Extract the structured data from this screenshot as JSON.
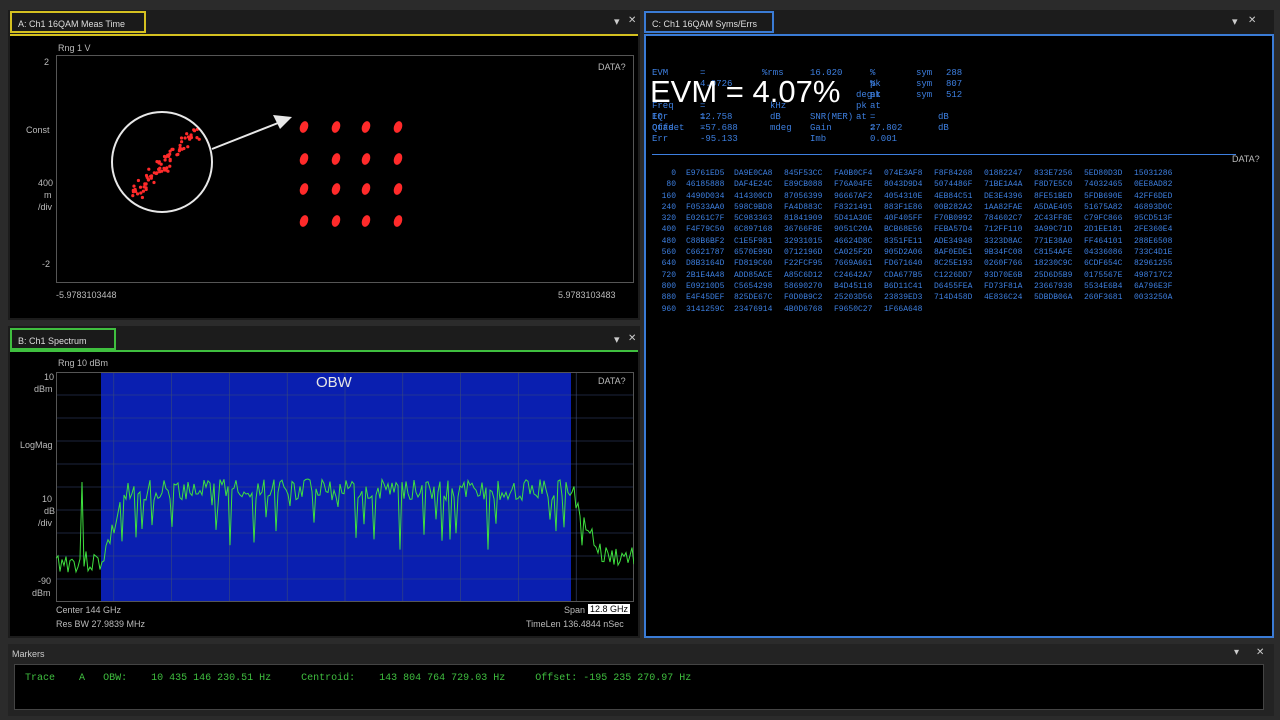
{
  "colors": {
    "panel_a_border": "#d4c020",
    "panel_b_border": "#3fbf3f",
    "panel_c_border": "#3a7bd5",
    "trace": "#3fe03f",
    "obw_fill": "#0a1fb0",
    "const_point": "#ff2a2a",
    "data_blue": "#3d7fe0"
  },
  "panel_a": {
    "title": "A: Ch1 16QAM Meas Time",
    "range": "Rng 1  V",
    "data_tag": "DATA?",
    "y_top": "2",
    "y_label": "Const",
    "y_mid": "400",
    "y_mid_unit1": "m",
    "y_mid_unit2": "/div",
    "y_bottom": "-2",
    "x_left": "-5.9783103448",
    "x_right": "5.9783103483"
  },
  "panel_b": {
    "title": "B: Ch1 Spectrum",
    "range": "Rng 10  dBm",
    "data_tag": "DATA?",
    "obw_label": "OBW",
    "y_top": "10",
    "y_top_unit": "dBm",
    "y_label": "LogMag",
    "y_scale": "10",
    "y_scale_unit1": "dB",
    "y_scale_unit2": "/div",
    "y_bottom": "-90",
    "y_bottom_unit": "dBm",
    "center": "Center 144 GHz",
    "res_bw": "Res BW 27.9839 MHz",
    "span_label": "Span",
    "span_value": "12.8 GHz",
    "timelen": "TimeLen 136.4844 nSec"
  },
  "panel_c": {
    "title": "C: Ch1 16QAM Syms/Errs",
    "evm_big": "EVM = 4.07%",
    "data_tag": "DATA?",
    "stats_row1": [
      "EVM",
      "= 4.0726",
      "%rms",
      "16.020",
      "% pk at",
      "sym",
      "288"
    ],
    "stats_row2": [
      "",
      "",
      "",
      "",
      "% pk at",
      "sym",
      "807"
    ],
    "stats_row3": [
      "",
      "",
      "",
      "",
      "deg pk at",
      "sym",
      "512"
    ],
    "freq_err": [
      "Freq Err",
      "= 12.758",
      "kHz"
    ],
    "iq_offset": [
      "IQ Offset",
      "= -57.688",
      "dB",
      "SNR(MER)",
      "= 27.802",
      "dB"
    ],
    "quad_err": [
      "Quad Err",
      "= -95.133",
      "mdeg",
      "Gain Imb",
      "= 0.001",
      "dB"
    ],
    "rows": [
      [
        "0",
        "E9761ED5",
        "DA9E0CA8",
        "845F53CC",
        "FA0B0CF4",
        "074E3AF8",
        "F8F84268",
        "01882247",
        "833E7256",
        "5ED80D3D",
        "15031286"
      ],
      [
        "80",
        "46185888",
        "DAF4E24C",
        "E89CB088",
        "F76A04FE",
        "8043D9D4",
        "5074486F",
        "71BE1A4A",
        "F8D7E5C0",
        "74032465",
        "0EE8AD82"
      ],
      [
        "160",
        "4490D034",
        "414300CD",
        "87056399",
        "96667AF2",
        "4054310E",
        "4EB84C51",
        "DE3E4396",
        "8FE51BED",
        "5FDB690E",
        "42FF6DED"
      ],
      [
        "240",
        "F0533AA0",
        "598C9BD8",
        "FA4D883C",
        "F8321491",
        "883F1E86",
        "00B282A2",
        "1AA82FAE",
        "A5DAE405",
        "51675A82",
        "46893D0C"
      ],
      [
        "320",
        "E0261C7F",
        "5C983363",
        "81841909",
        "5D41A30E",
        "40F405FF",
        "F70B0992",
        "784602C7",
        "2C43FF8E",
        "C79FC866",
        "95CD513F"
      ],
      [
        "400",
        "F4F79C50",
        "6C897168",
        "36766F8E",
        "9051C20A",
        "BCB68E56",
        "FEBA57D4",
        "712FF110",
        "3A99C71D",
        "2D1EE181",
        "2FE360E4"
      ],
      [
        "480",
        "C88B6BF2",
        "C1E5F981",
        "32931015",
        "46624D8C",
        "8351FE11",
        "ADE34948",
        "3323D8AC",
        "771E38A0",
        "FF464101",
        "288E6508"
      ],
      [
        "560",
        "C6621787",
        "6570E99D",
        "0712196D",
        "CA025F2D",
        "905D2A06",
        "8AF0EDE1",
        "9B34FC08",
        "C8154AFE",
        "04336086",
        "733C4D1E"
      ],
      [
        "640",
        "D8B3164D",
        "FD819C60",
        "F22FCF95",
        "7669A661",
        "FD671640",
        "8C25E193",
        "0260F766",
        "18230C9C",
        "6CDF654C",
        "82961255"
      ],
      [
        "720",
        "2B1E4A48",
        "ADD85ACE",
        "A85C6D12",
        "C24642A7",
        "CDA677B5",
        "C1226DD7",
        "93D70E6B",
        "25D6D5B9",
        "0175567E",
        "498717C2"
      ],
      [
        "800",
        "E09210D5",
        "C5654298",
        "58690270",
        "B4D45118",
        "B6D11C41",
        "D6455FEA",
        "FD73F81A",
        "23667938",
        "5534E6B4",
        "6A796E3F"
      ],
      [
        "880",
        "E4F45DEF",
        "825DE67C",
        "F0D0B9C2",
        "25203D56",
        "23839ED3",
        "714D458D",
        "4E836C24",
        "5DBDB06A",
        "260F3681",
        "0033250A"
      ],
      [
        "960",
        "3141259C",
        "23476914",
        "4B0D6768",
        "F9650C27",
        "1F66A648",
        "",
        "",
        "",
        "",
        ""
      ]
    ]
  },
  "markers": {
    "title": "Markers",
    "trace_label": "Trace",
    "trace_id": "A",
    "obw_key": "OBW:",
    "obw_val": "10 435 146 230.51 Hz",
    "centroid_key": "Centroid:",
    "centroid_val": "143 804 764 729.03 Hz",
    "offset_key": "Offset:",
    "offset_val": "-195 235 270.97 Hz"
  },
  "window_controls": {
    "pin": "▾",
    "close": "✕"
  }
}
